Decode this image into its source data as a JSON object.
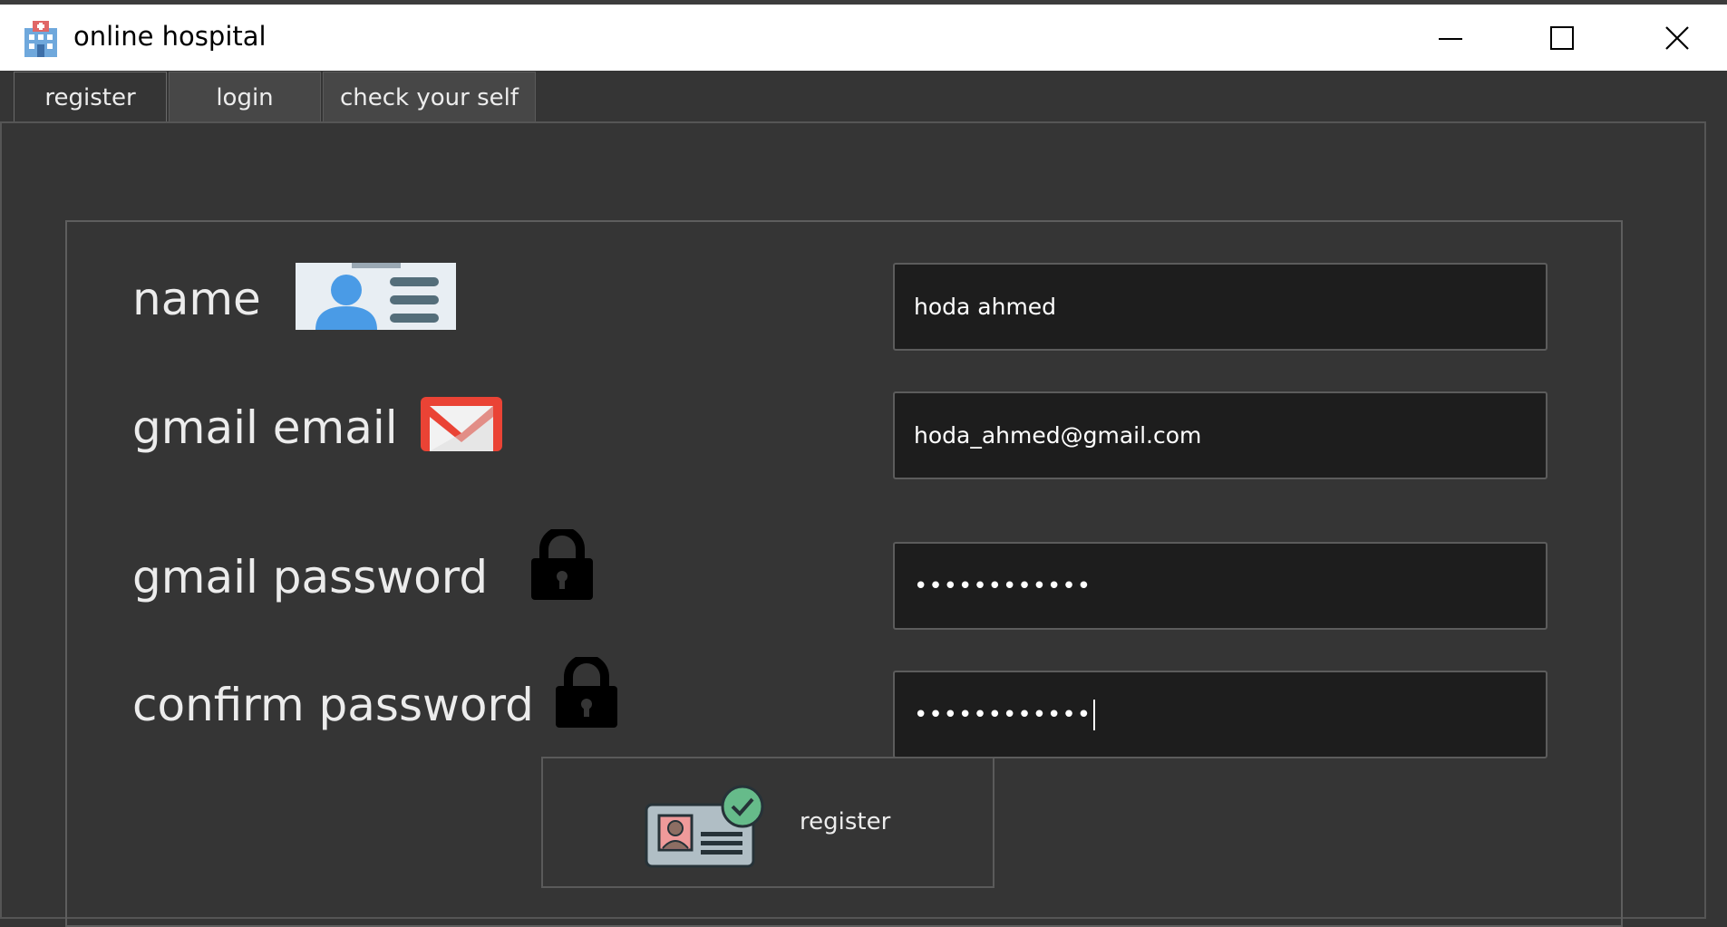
{
  "window": {
    "title": "online hospital",
    "icons": {
      "app": "hospital-icon",
      "minimize": "minimize-icon",
      "maximize": "maximize-icon",
      "close": "close-icon"
    }
  },
  "tabs": [
    {
      "label": "register",
      "active": true
    },
    {
      "label": "login",
      "active": false
    },
    {
      "label": "check your self",
      "active": false
    }
  ],
  "form": {
    "name_label": "name",
    "email_label": "gmail email",
    "password_label": "gmail password",
    "confirm_label": "confirm password",
    "name_value": "hoda ahmed",
    "email_value": "hoda_ahmed@gmail.com",
    "password_masked": "••••••••••••",
    "confirm_masked": "••••••••••••",
    "icons": {
      "name": "id-card-icon",
      "email": "gmail-icon",
      "password": "lock-icon",
      "confirm": "lock-icon"
    }
  },
  "register_button": {
    "label": "register",
    "icon": "registration-card-icon"
  },
  "colors": {
    "background": "#353535",
    "field_background": "#1d1d1d",
    "text": "#ececec",
    "gmail_red": "#ea4335",
    "id_blue": "#4a9be6"
  }
}
